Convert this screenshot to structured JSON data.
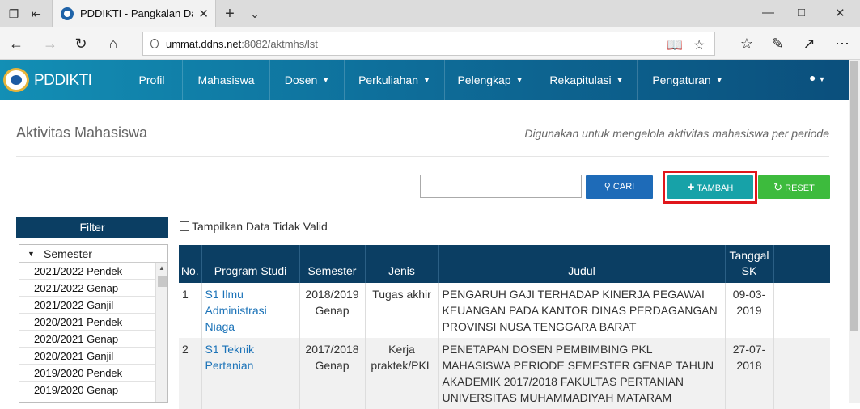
{
  "browser": {
    "tab_title": "PDDIKTI - Pangkalan Da",
    "url_host": "ummat.ddns.net",
    "url_path": ":8082/aktmhs/lst"
  },
  "app": {
    "brand": "PDDIKTI",
    "nav": [
      {
        "label": "Profil",
        "has_caret": false
      },
      {
        "label": "Mahasiswa",
        "has_caret": false
      },
      {
        "label": "Dosen",
        "has_caret": true
      },
      {
        "label": "Perkuliahan",
        "has_caret": true
      },
      {
        "label": "Pelengkap",
        "has_caret": true
      },
      {
        "label": "Rekapitulasi",
        "has_caret": true
      },
      {
        "label": "Pengaturan",
        "has_caret": true
      }
    ]
  },
  "page": {
    "title": "Aktivitas Mahasiswa",
    "subtitle": "Digunakan untuk mengelola aktivitas mahasiswa per periode"
  },
  "toolbar": {
    "search_value": "",
    "cari_label": "CARI",
    "tambah_label": "TAMBAH",
    "reset_label": "RESET",
    "colors": {
      "cari": "#1e6bb8",
      "tambah": "#17a2a8",
      "reset": "#3dbb3d",
      "highlight": "#e0161b"
    }
  },
  "filter": {
    "title": "Filter",
    "group_label": "Semester",
    "items": [
      "2021/2022 Pendek",
      "2021/2022 Genap",
      "2021/2022 Ganjil",
      "2020/2021 Pendek",
      "2020/2021 Genap",
      "2020/2021 Ganjil",
      "2019/2020 Pendek",
      "2019/2020 Genap"
    ]
  },
  "table": {
    "checkbox_label": "Tampilkan Data Tidak Valid",
    "headers": {
      "no": "No.",
      "prodi": "Program Studi",
      "semester": "Semester",
      "jenis": "Jenis",
      "judul": "Judul",
      "tanggal": "Tanggal SK"
    },
    "rows": [
      {
        "no": "1",
        "prodi": "S1 Ilmu Administrasi Niaga",
        "semester": "2018/2019 Genap",
        "jenis": "Tugas akhir",
        "judul": "PENGARUH GAJI TERHADAP KINERJA PEGAWAI KEUANGAN PADA KANTOR DINAS PERDAGANGAN PROVINSI NUSA TENGGARA BARAT",
        "tanggal": "09-03-2019"
      },
      {
        "no": "2",
        "prodi": "S1 Teknik Pertanian",
        "semester": "2017/2018 Genap",
        "jenis": "Kerja praktek/PKL",
        "judul": "PENETAPAN DOSEN PEMBIMBING PKL MAHASISWA PERIODE SEMESTER GENAP TAHUN AKADEMIK 2017/2018 FAKULTAS PERTANIAN UNIVERSITAS MUHAMMADIYAH MATARAM",
        "tanggal": "27-07-2018"
      }
    ]
  }
}
